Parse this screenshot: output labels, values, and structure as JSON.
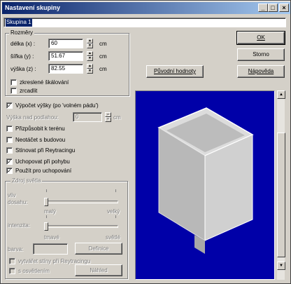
{
  "window": {
    "title": "Nastavení skupiny",
    "controls": {
      "minimize": "_",
      "maximize": "□",
      "close": "×"
    }
  },
  "name_field": {
    "value": "Skupina 1"
  },
  "dimensions": {
    "legend": "Rozměry",
    "fields": [
      {
        "label": "délka (x) :",
        "value": "60",
        "unit": "cm"
      },
      {
        "label": "šířka (y) :",
        "value": "51.67",
        "unit": "cm"
      },
      {
        "label": "výška (z) :",
        "value": "82.55",
        "unit": "cm"
      }
    ],
    "checkboxes": [
      {
        "label": "zkreslené škálování",
        "checked": false
      },
      {
        "label": "zrcadlit",
        "checked": false
      }
    ]
  },
  "buttons": {
    "ok": "OK",
    "cancel": "Storno",
    "help": "Nápověda",
    "original": "Původní hodnoty"
  },
  "options": {
    "height_calc": {
      "label": "Výpočet výšky (po 'volném pádu')",
      "checked": true
    },
    "floor_height": {
      "label": "Výška nad podlahou:",
      "value": "0",
      "unit": "cm"
    },
    "items": [
      {
        "label": "Přizpůsobit k terénu",
        "checked": false
      },
      {
        "label": "Neotáčet s budovou",
        "checked": false
      },
      {
        "label": "Stínovat při Reytracingu",
        "checked": false
      },
      {
        "label": "Uchopovat při pohybu",
        "checked": true
      },
      {
        "label": "Použít pro uchopování",
        "checked": true
      }
    ]
  },
  "light_source": {
    "legend": "Zdroj světla",
    "influence_label_1": "vliv",
    "influence_label_2": "dosahu:",
    "influence_min": "malý",
    "influence_max": "velký",
    "influence_level": 0.0,
    "intensity_label": "intenzita:",
    "intensity_min": "tmavé",
    "intensity_max": "světlé",
    "intensity_level": 0.0,
    "color_label": "barva:",
    "define_button": "Definice",
    "shadows": {
      "label": "vytvářet stíny při Reytracingu",
      "checked": false
    },
    "lighting": {
      "label": "s osvětlením",
      "checked": false
    },
    "preview_button": "Náhled"
  },
  "preview": {
    "background": "#0000a8",
    "box_color": "#c8c8c8"
  }
}
